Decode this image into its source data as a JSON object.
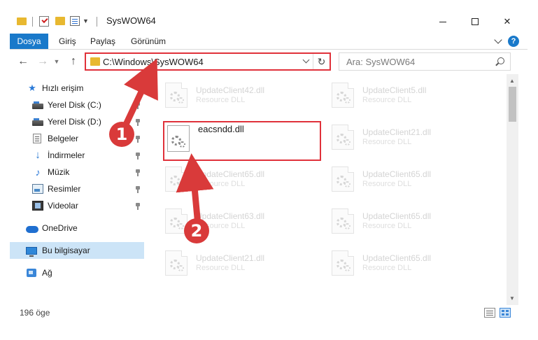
{
  "window": {
    "title": "SysWOW64"
  },
  "ribbon": {
    "tabs": [
      "Dosya",
      "Giriş",
      "Paylaş",
      "Görünüm"
    ],
    "help_label": "?"
  },
  "navigation": {
    "address": "C:\\Windows\\SysWOW64",
    "search_placeholder": "Ara: SysWOW64"
  },
  "sidebar": {
    "items": [
      {
        "label": "Hızlı erişim",
        "icon": "star-icon",
        "pinned": false
      },
      {
        "label": "Yerel Disk (C:)",
        "icon": "drive-icon",
        "pinned": true
      },
      {
        "label": "Yerel Disk (D:)",
        "icon": "drive-icon",
        "pinned": true
      },
      {
        "label": "Belgeler",
        "icon": "documents-icon",
        "pinned": true
      },
      {
        "label": "İndirmeler",
        "icon": "download-icon",
        "pinned": true
      },
      {
        "label": "Müzik",
        "icon": "music-icon",
        "pinned": true
      },
      {
        "label": "Resimler",
        "icon": "pictures-icon",
        "pinned": true
      },
      {
        "label": "Videolar",
        "icon": "videos-icon",
        "pinned": true
      },
      {
        "label": "OneDrive",
        "icon": "cloud-icon",
        "pinned": false
      },
      {
        "label": "Bu bilgisayar",
        "icon": "pc-icon",
        "pinned": false,
        "selected": true
      },
      {
        "label": "Ağ",
        "icon": "network-icon",
        "pinned": false
      }
    ]
  },
  "files": [
    {
      "name": "UpdateClient42.dll",
      "type": "Resource DLL"
    },
    {
      "name": "UpdateClient5.dll",
      "type": "Resource DLL"
    },
    {
      "name": "eacsndd.dll",
      "type": "",
      "highlighted": true
    },
    {
      "name": "UpdateClient21.dll",
      "type": "Resource DLL"
    },
    {
      "name": "UpdateClient65.dll",
      "type": "Resource DLL"
    },
    {
      "name": "UpdateClient65.dll",
      "type": "Resource DLL"
    },
    {
      "name": "UpdateClient63.dll",
      "type": "Resource DLL"
    },
    {
      "name": "UpdateClient65.dll",
      "type": "Resource DLL"
    },
    {
      "name": "UpdateClient21.dll",
      "type": "Resource DLL"
    },
    {
      "name": "UpdateClient65.dll",
      "type": "Resource DLL"
    }
  ],
  "status": {
    "item_count": "196 öge"
  },
  "annotations": {
    "step1": "1",
    "step2": "2",
    "color": "#d93a3a"
  },
  "colors": {
    "accent": "#1979ca",
    "highlight_border": "#e0313a",
    "selection": "#cce4f7"
  }
}
